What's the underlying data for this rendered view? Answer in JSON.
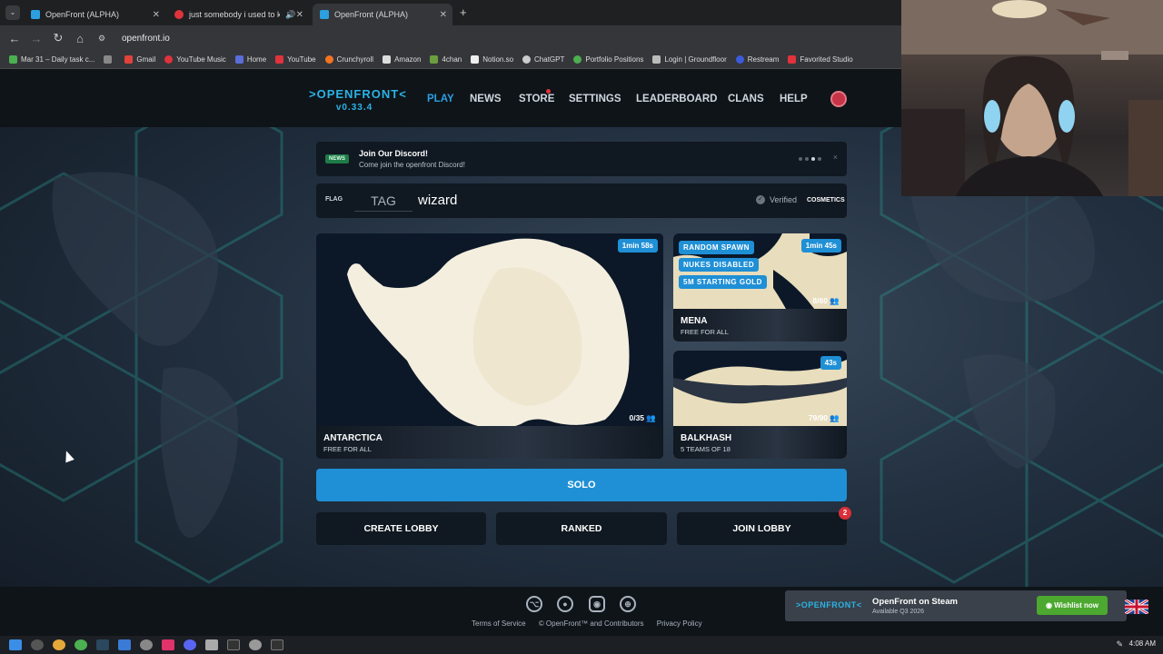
{
  "browser": {
    "tabs": [
      {
        "title": "OpenFront (ALPHA)",
        "active": false
      },
      {
        "title": "just somebody i used to kn",
        "active": false
      },
      {
        "title": "OpenFront (ALPHA)",
        "active": true
      }
    ],
    "url": "openfront.io",
    "bookmarks": [
      "Mar 31 – Daily task c...",
      "Gmail",
      "YouTube Music",
      "Home",
      "YouTube",
      "Crunchyroll",
      "Amazon",
      "4chan",
      "Notion.so",
      "ChatGPT",
      "Portfolio Positions",
      "Login | Groundfloor",
      "Restream",
      "Favorited Studio"
    ]
  },
  "nav": {
    "logo": ">OPENFRONT<",
    "version": "v0.33.4",
    "links": [
      "PLAY",
      "NEWS",
      "STORE",
      "SETTINGS",
      "LEADERBOARD",
      "CLANS",
      "HELP"
    ]
  },
  "news": {
    "badge": "NEWS",
    "title": "Join Our Discord!",
    "subtitle": "Come join the openfront Discord!",
    "close": "×"
  },
  "user": {
    "flag_label": "FLAG",
    "tag_placeholder": "TAG",
    "username": "wizard",
    "verified": "Verified",
    "cosmetics": "COSMETICS"
  },
  "lobbies": {
    "main": {
      "timer": "1min 58s",
      "count": "0/35",
      "name": "ANTARCTICA",
      "mode": "FREE FOR ALL"
    },
    "mena": {
      "timer": "1min 45s",
      "chips": [
        "RANDOM SPAWN",
        "NUKES DISABLED",
        "5M STARTING GOLD"
      ],
      "count": "8/60",
      "name": "MENA",
      "mode": "FREE FOR ALL"
    },
    "balkhash": {
      "timer": "43s",
      "count": "79/90",
      "name": "BALKHASH",
      "mode": "5 TEAMS OF 18"
    }
  },
  "buttons": {
    "solo": "SOLO",
    "create": "CREATE LOBBY",
    "ranked": "RANKED",
    "join": "JOIN LOBBY",
    "join_badge": "2"
  },
  "footer": {
    "links": [
      "Terms of Service",
      "© OpenFront™ and Contributors",
      "Privacy Policy"
    ],
    "steam_logo": ">OPENFRONT<",
    "steam_title": "OpenFront on Steam",
    "steam_sub": "Available Q3 2026",
    "wishlist": "Wishlist now"
  },
  "taskbar": {
    "clock": "4:08 AM"
  },
  "colors": {
    "accent": "#1f90d6",
    "brand": "#2bb3e6",
    "alert": "#d9303a",
    "wishlist": "#4ca82f"
  }
}
